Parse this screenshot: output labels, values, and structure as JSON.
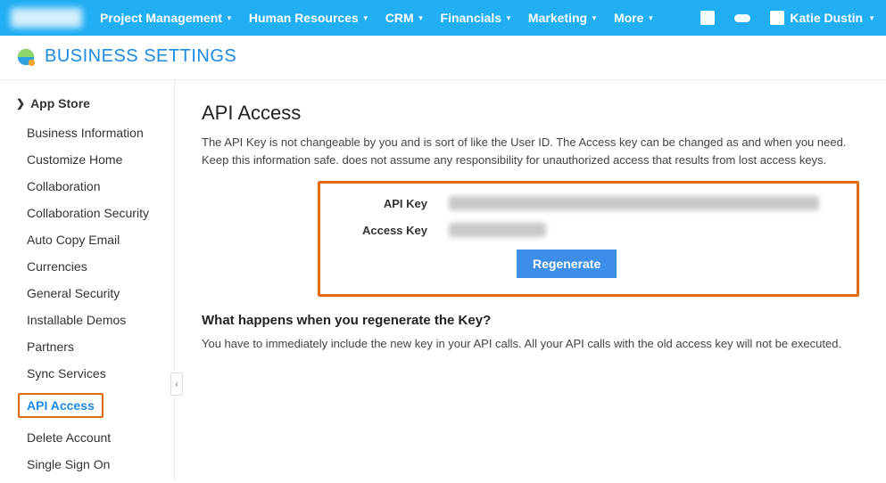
{
  "nav": {
    "items": [
      "Project Management",
      "Human Resources",
      "CRM",
      "Financials",
      "Marketing",
      "More"
    ],
    "user_name": "Katie Dustin"
  },
  "page_title": "BUSINESS SETTINGS",
  "sidebar": {
    "header": "App Store",
    "items": [
      "Business Information",
      "Customize Home",
      "Collaboration",
      "Collaboration Security",
      "Auto Copy Email",
      "Currencies",
      "General Security",
      "Installable Demos",
      "Partners",
      "Sync Services",
      "API Access",
      "Delete Account",
      "Single Sign On"
    ],
    "active_index": 10
  },
  "main": {
    "heading": "API Access",
    "description": "The API Key is not changeable by you and is sort of like the User ID. The Access key can be changed as and when you need. Keep this information safe. does not assume any responsibility for unauthorized access that results from lost access keys.",
    "api_key_label": "API Key",
    "access_key_label": "Access Key",
    "regenerate_label": "Regenerate",
    "subheading": "What happens when you regenerate the Key?",
    "subdescription": "You have to immediately include the new key in your API calls. All your API calls with the old access key will not be executed."
  }
}
